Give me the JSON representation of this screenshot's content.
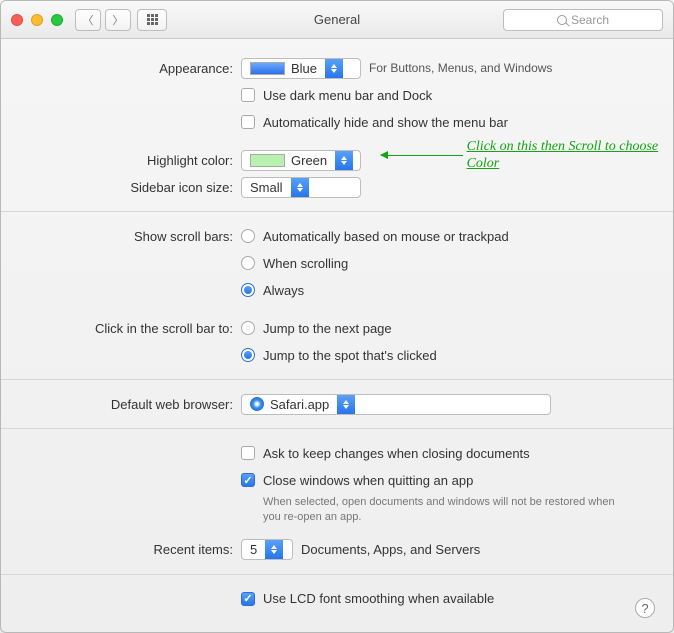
{
  "window": {
    "title": "General",
    "search_placeholder": "Search"
  },
  "appearance": {
    "label": "Appearance:",
    "value": "Blue",
    "hint": "For Buttons, Menus, and Windows",
    "dark_menu": "Use dark menu bar and Dock",
    "auto_hide": "Automatically hide and show the menu bar"
  },
  "highlight": {
    "label": "Highlight color:",
    "value": "Green"
  },
  "sidebar": {
    "label": "Sidebar icon size:",
    "value": "Small"
  },
  "scroll": {
    "label": "Show scroll bars:",
    "opt1": "Automatically based on mouse or trackpad",
    "opt2": "When scrolling",
    "opt3": "Always"
  },
  "click": {
    "label": "Click in the scroll bar to:",
    "opt1": "Jump to the next page",
    "opt2": "Jump to the spot that's clicked"
  },
  "browser": {
    "label": "Default web browser:",
    "value": "Safari.app"
  },
  "docs": {
    "ask": "Ask to keep changes when closing documents",
    "close": "Close windows when quitting an app",
    "note": "When selected, open documents and windows will not be restored when you re-open an app."
  },
  "recent": {
    "label": "Recent items:",
    "value": "5",
    "hint": "Documents, Apps, and Servers"
  },
  "lcd": "Use LCD font smoothing when available",
  "annotation": "Click on this then Scroll to choose Color"
}
